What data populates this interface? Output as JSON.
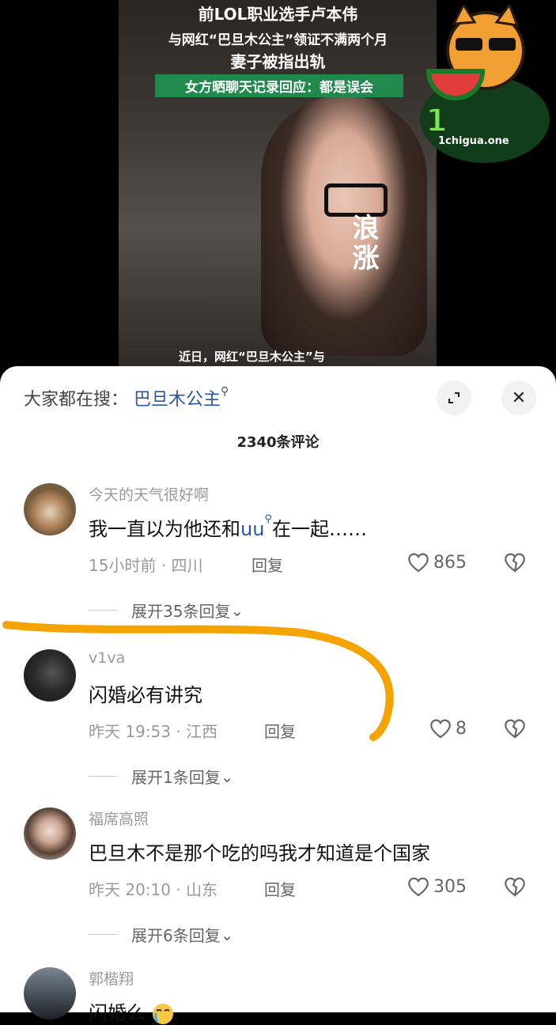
{
  "video": {
    "headline_1": "前LOL职业选手卢本伟",
    "headline_2": "与网红“巴旦木公主”领证不满两个月",
    "headline_3": "妻子被指出轨",
    "headline_4": "女方晒聊天记录回应：都是误会",
    "watermark": "浪涨",
    "caption": "近日，网红“巴旦木公主”与"
  },
  "logo": {
    "name": "1吃瓜",
    "domain": "1chigua.one"
  },
  "search": {
    "prefix": "大家都在搜：",
    "keyword": "巴旦木公主"
  },
  "comments_count": "2340条评论",
  "comments": [
    {
      "username": "今天的天气很好啊",
      "text_before": "我一直以为他还和",
      "mention": "uu",
      "text_after": "在一起……",
      "meta": "15小时前 · 四川",
      "reply": "回复",
      "likes": "865",
      "expand": "展开35条回复"
    },
    {
      "username": "v1va",
      "text": "闪婚必有讲究",
      "meta": "昨天 19:53 · 江西",
      "reply": "回复",
      "likes": "8",
      "expand": "展开1条回复"
    },
    {
      "username": "福席高照",
      "text": "巴旦木不是那个吃的吗我才知道是个国家",
      "meta": "昨天 20:10 · 山东",
      "reply": "回复",
      "likes": "305",
      "expand": "展开6条回复"
    },
    {
      "username": "郭楷翔",
      "text": "闪婚么"
    }
  ],
  "colors": {
    "accent": "#2b56a3",
    "highlight_stroke": "#f5a300"
  }
}
